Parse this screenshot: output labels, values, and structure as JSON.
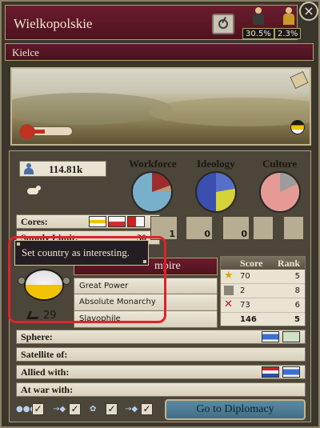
{
  "window": {
    "title": "Wielkopolskie",
    "state_name": "Kielce",
    "stats": [
      {
        "icon": "capitalist-icon",
        "value": "30.5%"
      },
      {
        "icon": "clergy-icon",
        "value": "2.3%"
      }
    ],
    "close_label": "×"
  },
  "overview": {
    "population": "114.81k",
    "pies": [
      {
        "label": "Workforce",
        "colors": [
          "#78b0cc",
          "#9b2d2d",
          "#b59a7c"
        ]
      },
      {
        "label": "Ideology",
        "colors": [
          "#3a4fb0",
          "#d6d23a",
          "#5670c8"
        ]
      },
      {
        "label": "Culture",
        "colors": [
          "#e59a96",
          "#9c9c9c"
        ]
      }
    ],
    "cores_label": "Cores:",
    "supply_label": "Supply Limit:",
    "supply_value": "30",
    "buildings": [
      {
        "icon": "fort-icon",
        "count": "1"
      },
      {
        "icon": "naval-base-icon",
        "count": "0"
      },
      {
        "icon": "railroad-icon",
        "count": "0"
      },
      {
        "icon": "factory-plus-icon",
        "count": ""
      },
      {
        "icon": "building-plus-icon",
        "count": ""
      }
    ]
  },
  "tooltip": {
    "text": "Set country as interesting."
  },
  "country": {
    "name_partial": "mpire",
    "status": [
      "Great Power",
      "Absolute Monarchy",
      "Slavophile"
    ],
    "military_score": "29"
  },
  "scores": {
    "header_score": "Score",
    "header_rank": "Rank",
    "rows": [
      {
        "icon": "star-icon",
        "score": "70",
        "rank": "5"
      },
      {
        "icon": "industry-icon",
        "score": "2",
        "rank": "8"
      },
      {
        "icon": "swords-icon",
        "score": "73",
        "rank": "6"
      }
    ],
    "total_score": "146",
    "total_rank": "5"
  },
  "relations": {
    "sphere_label": "Sphere:",
    "satellite_label": "Satellite of:",
    "allied_label": "Allied with:",
    "war_label": "At war with:"
  },
  "footer": {
    "diplomacy_button": "Go to Diplomacy",
    "checks": [
      "✓",
      "✓",
      "✓",
      "✓"
    ]
  }
}
